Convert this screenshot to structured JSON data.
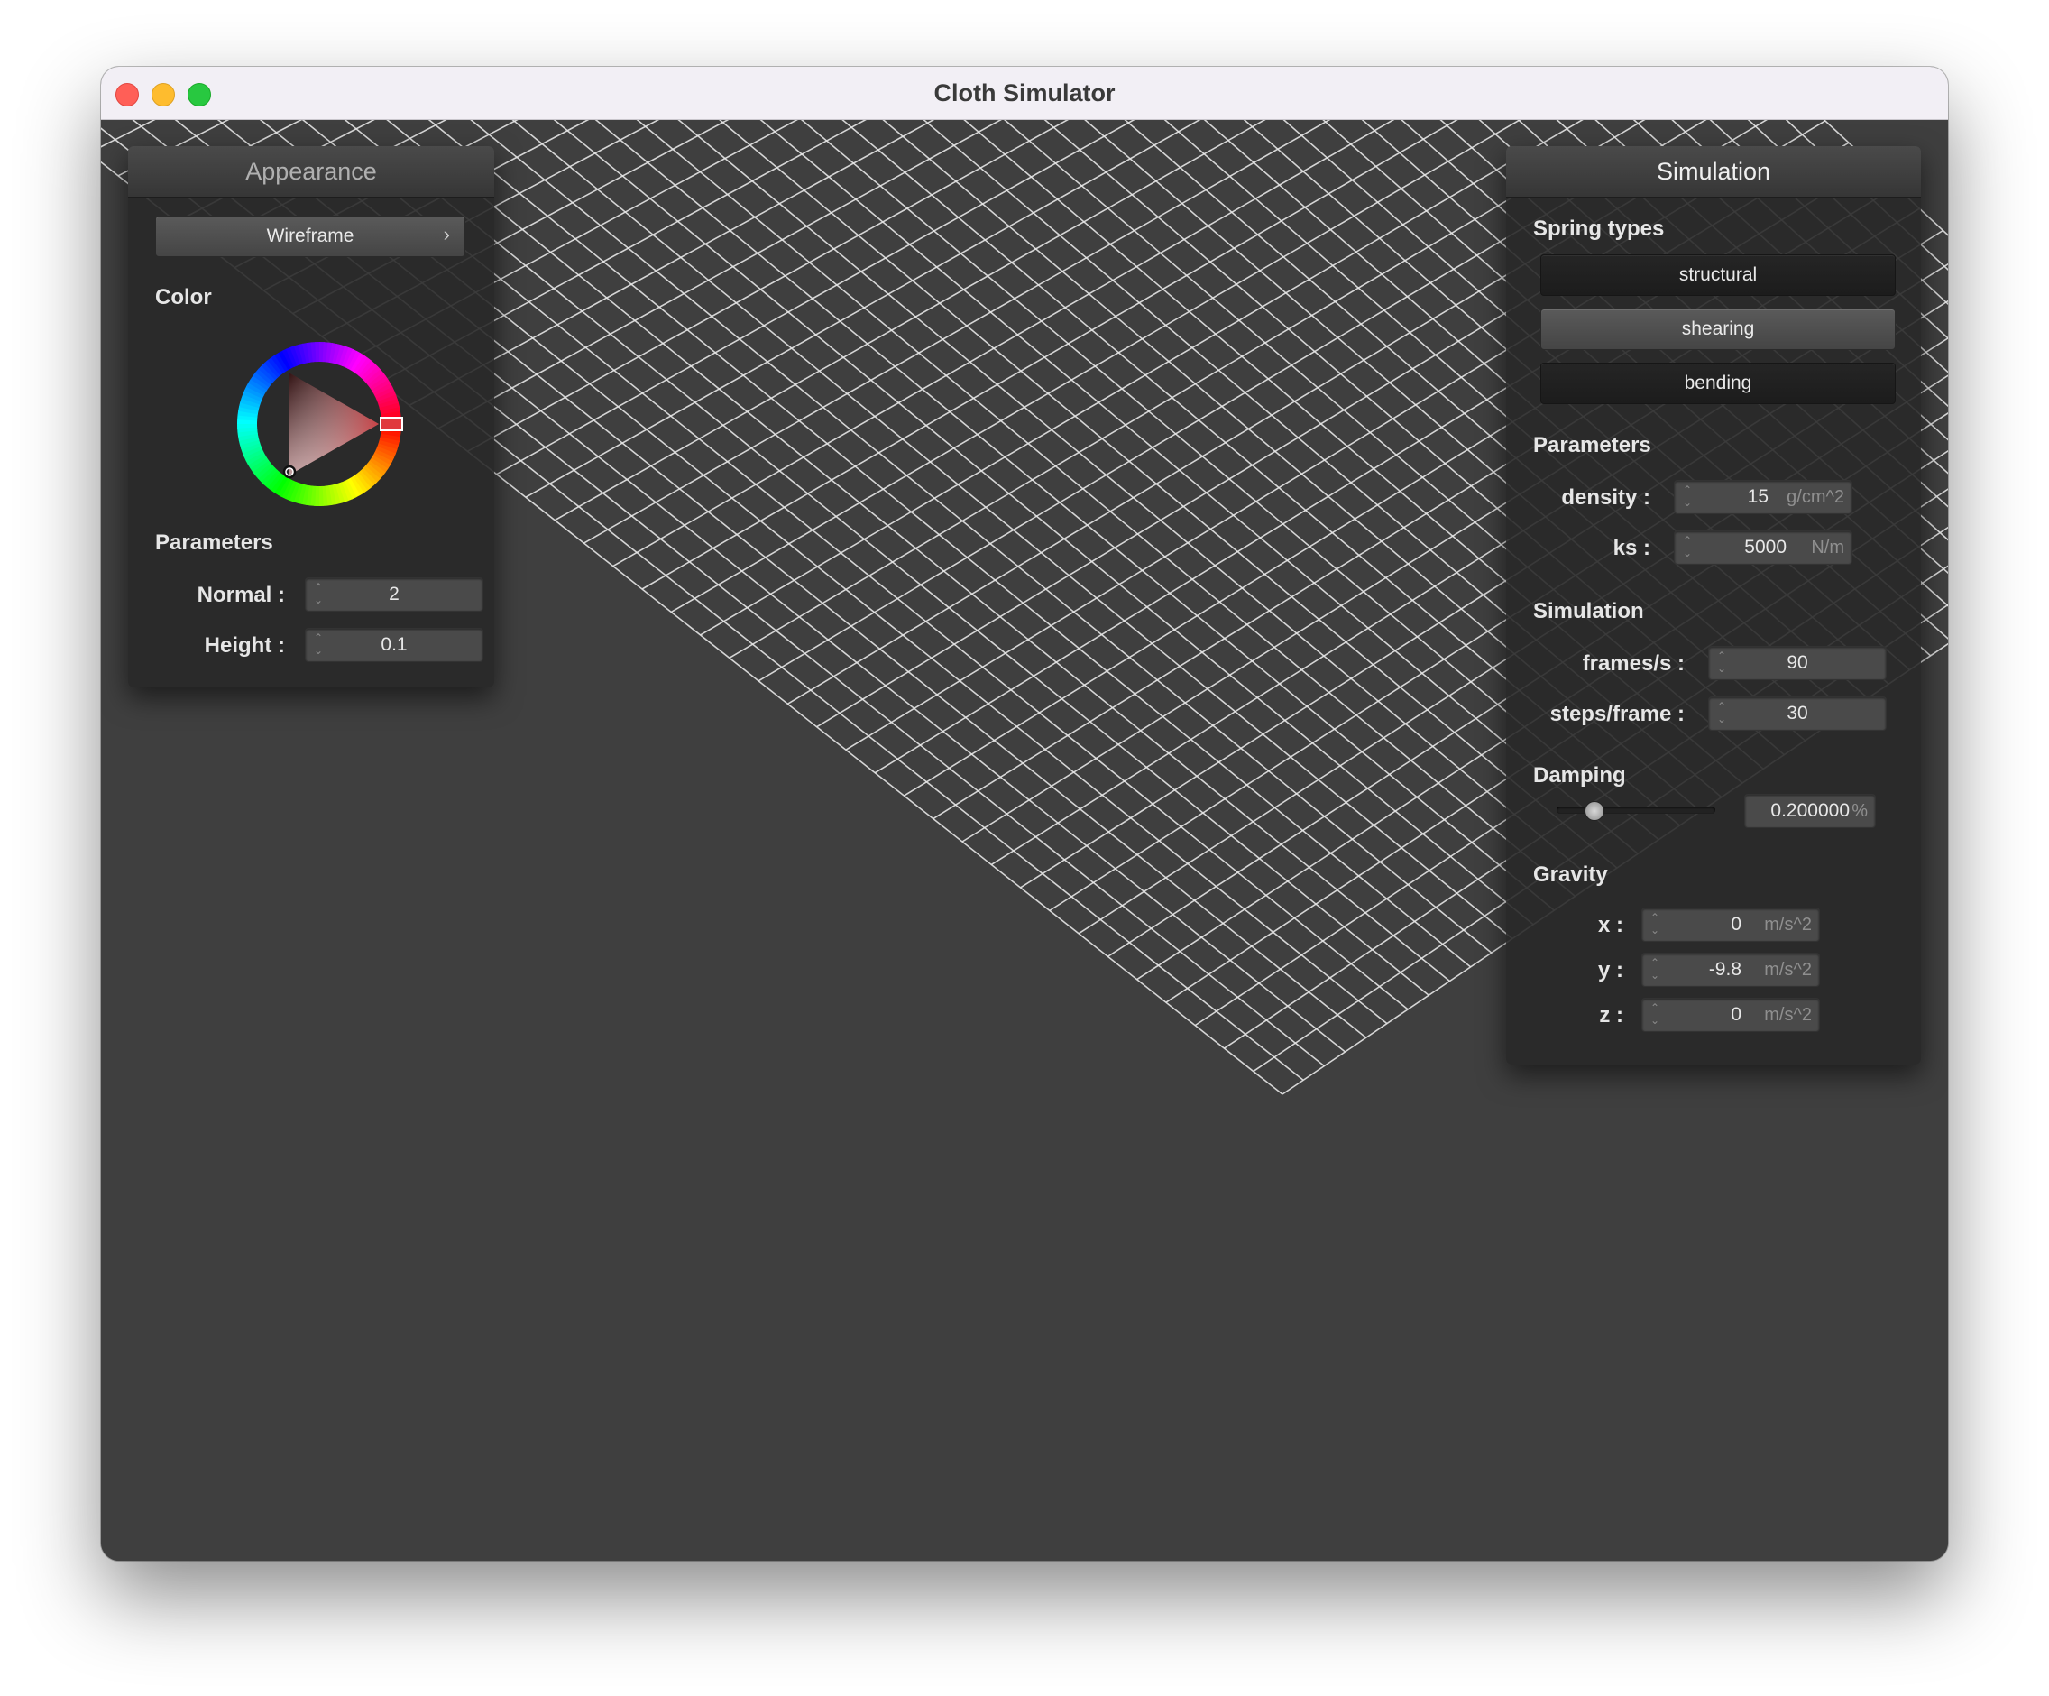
{
  "window": {
    "title": "Cloth Simulator"
  },
  "colors": {
    "accent": "#e0393e",
    "viewport_bg": "#3f3f3f",
    "mesh": "#e6e6e6"
  },
  "appearance": {
    "title": "Appearance",
    "shader_label": "Wireframe",
    "shader_arrow": "›",
    "color_label": "Color",
    "params_label": "Parameters",
    "normal_label": "Normal :",
    "normal_value": "2",
    "height_label": "Height :",
    "height_value": "0.1",
    "selected_color": "#e0393e"
  },
  "simulation": {
    "title": "Simulation",
    "spring_types_label": "Spring types",
    "springs": [
      "structural",
      "shearing",
      "bending"
    ],
    "params_label": "Parameters",
    "density_label": "density :",
    "density_value": "15",
    "density_unit": "g/cm^2",
    "ks_label": "ks :",
    "ks_value": "5000",
    "ks_unit": "N/m",
    "sim_label": "Simulation",
    "fps_label": "frames/s :",
    "fps_value": "90",
    "steps_label": "steps/frame :",
    "steps_value": "30",
    "damping_label": "Damping",
    "damping_value": "0.200000",
    "damping_unit": "%",
    "damping_fraction": 0.2,
    "gravity_label": "Gravity",
    "gx_label": "x :",
    "gx_value": "0",
    "gx_unit": "m/s^2",
    "gy_label": "y :",
    "gy_value": "-9.8",
    "gy_unit": "m/s^2",
    "gz_label": "z :",
    "gz_value": "0",
    "gz_unit": "m/s^2"
  },
  "icons": {
    "spinner": "updown-arrows-icon",
    "chevron": "chevron-right-icon"
  }
}
